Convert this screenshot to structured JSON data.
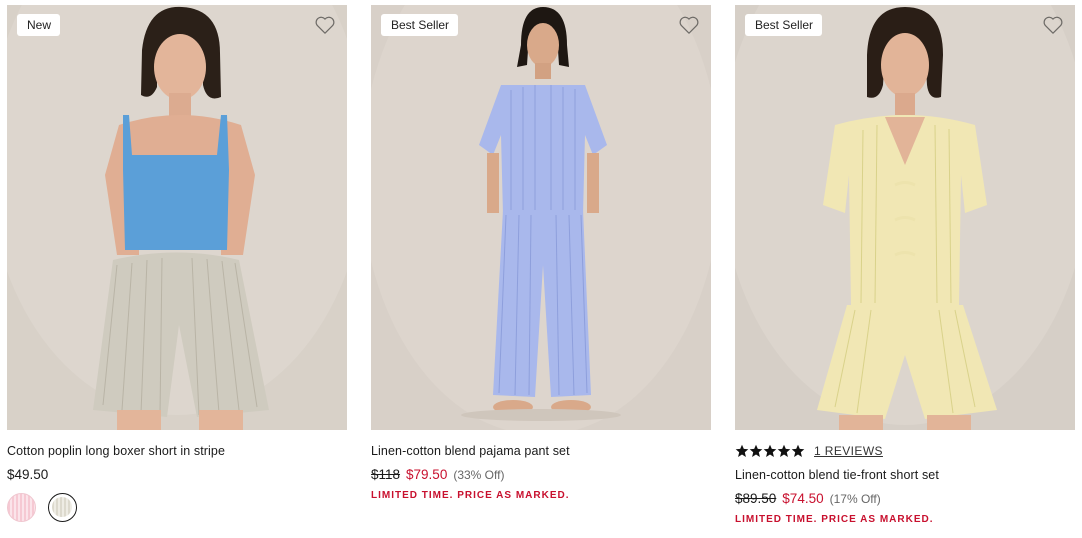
{
  "products": [
    {
      "badge": "New",
      "name": "Cotton poplin long boxer short in stripe",
      "price": "$49.50",
      "swatches": [
        "pink-stripe",
        "ivory-stripe"
      ],
      "selected_swatch": "ivory-stripe",
      "colors": {
        "background": "#d8d1c8",
        "top": "#5b9fd8",
        "shorts": "#cfcbbf"
      }
    },
    {
      "badge": "Best Seller",
      "name": "Linen-cotton blend pajama pant set",
      "price_was": "$118",
      "price_sale": "$79.50",
      "price_off": "(33% Off)",
      "promo": "LIMITED TIME. PRICE AS MARKED.",
      "colors": {
        "background": "#d8d0c8",
        "outfit": "#a9b8ec"
      }
    },
    {
      "badge": "Best Seller",
      "rating": 5,
      "reviews": "1 REVIEWS",
      "name": "Linen-cotton blend tie-front short set",
      "price_was": "$89.50",
      "price_sale": "$74.50",
      "price_off": "(17% Off)",
      "promo": "LIMITED TIME. PRICE AS MARKED.",
      "colors": {
        "background": "#d6cfc7",
        "outfit": "#f1e7b4"
      }
    }
  ],
  "icons": {
    "wishlist": "heart-outline-icon",
    "rating": "star-icon"
  },
  "accent_sale": "#c8102e"
}
